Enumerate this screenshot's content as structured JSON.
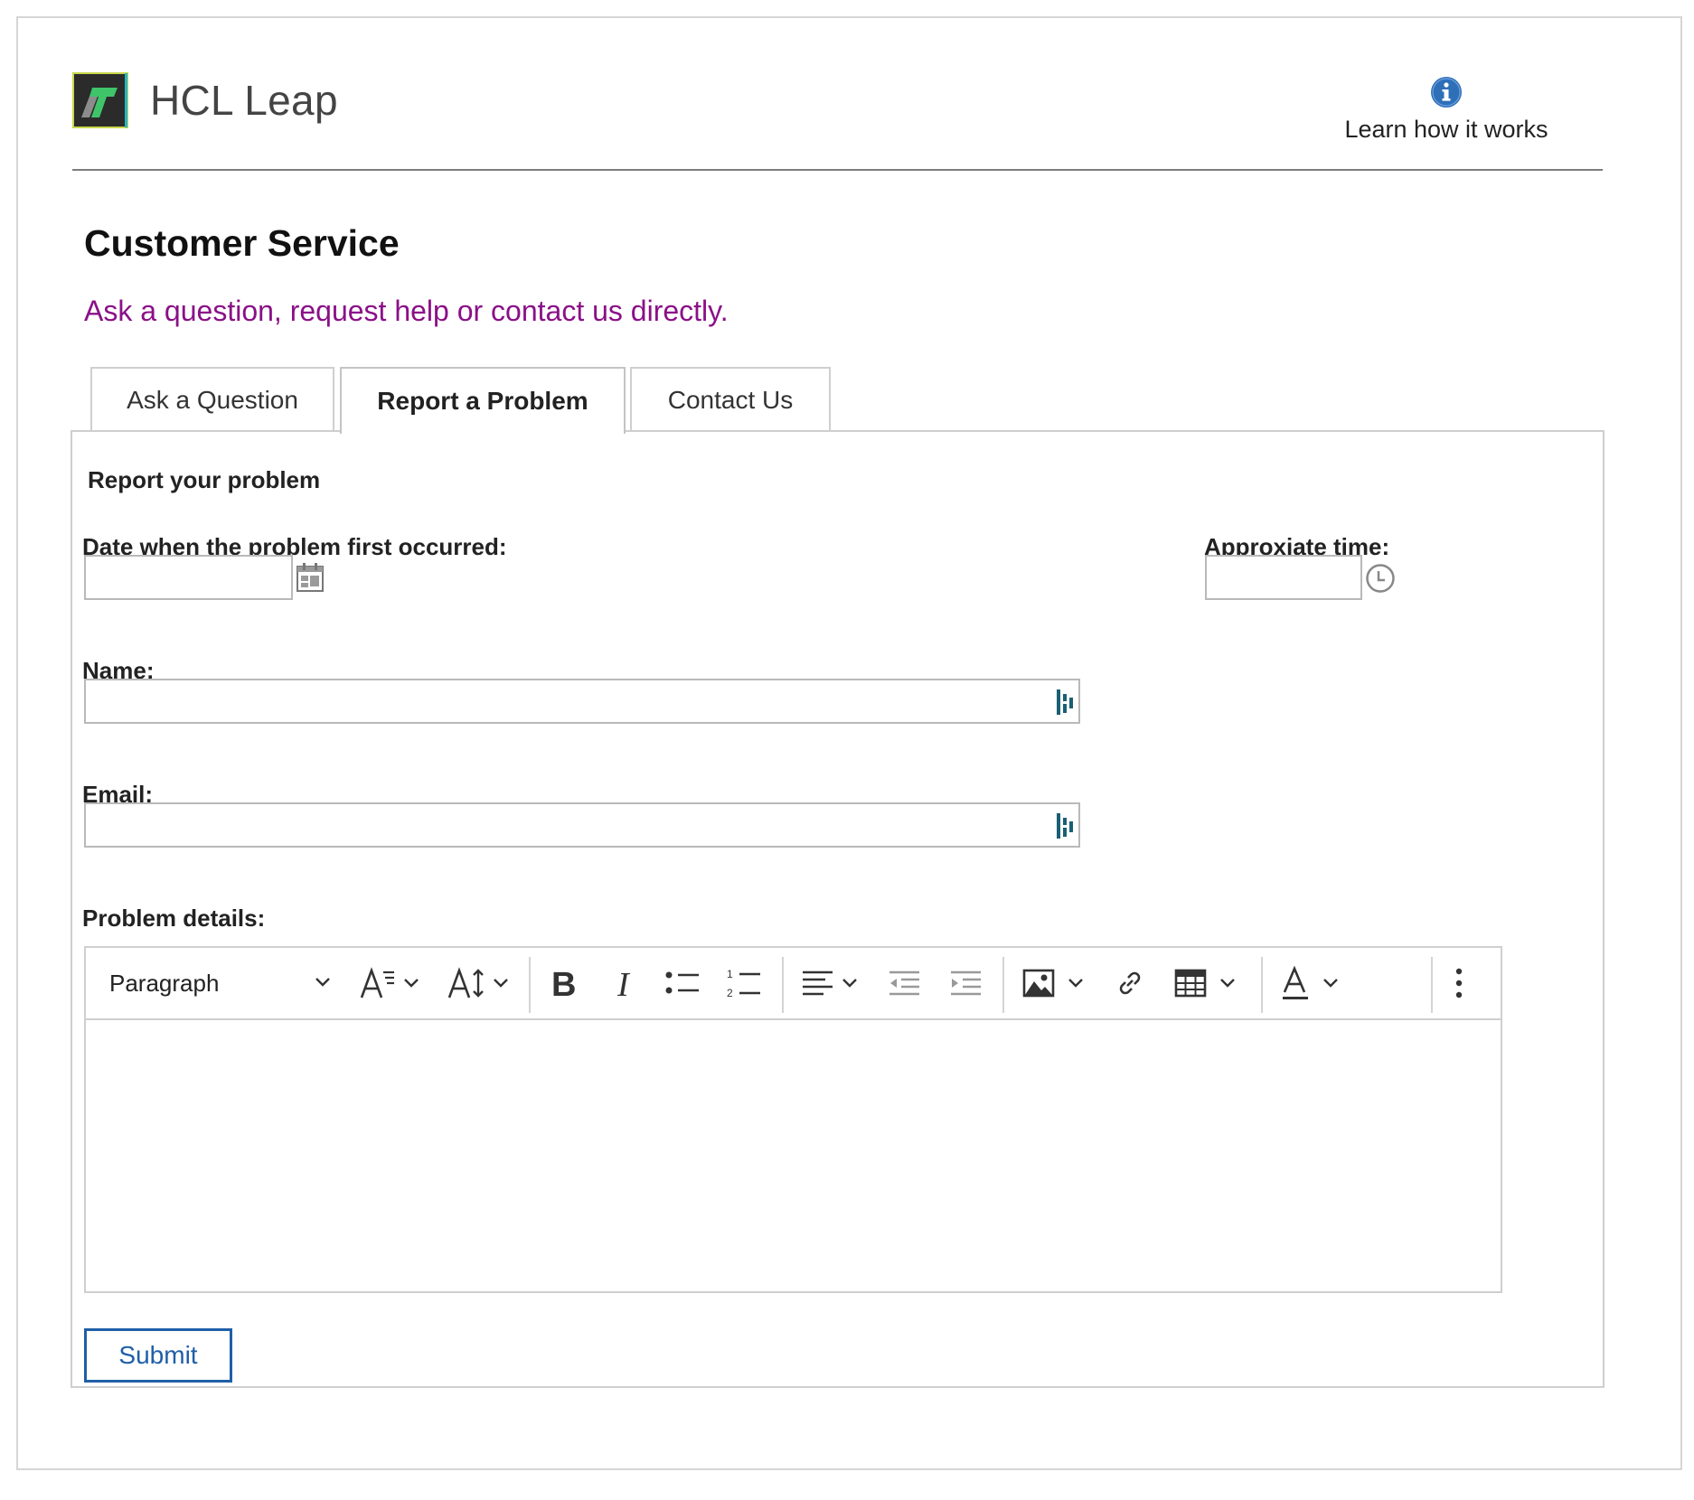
{
  "header": {
    "app_name": "HCL Leap",
    "help_link": "Learn how it works",
    "icons": {
      "logo": "hcl-leap-logo-icon",
      "help": "info-icon"
    }
  },
  "page": {
    "title": "Customer Service",
    "subtitle": "Ask a question, request help or contact us directly."
  },
  "tabs": [
    {
      "label": "Ask a Question",
      "active": false
    },
    {
      "label": "Report a Problem",
      "active": true
    },
    {
      "label": "Contact Us",
      "active": false
    }
  ],
  "form": {
    "section_title": "Report your problem",
    "date_label": "Date when the problem first occurred:",
    "date_value": "",
    "time_label": "Approxiate time:",
    "time_value": "",
    "name_label": "Name:",
    "name_value": "",
    "email_label": "Email:",
    "email_value": "",
    "details_label": "Problem details:",
    "details_value": "",
    "submit_label": "Submit"
  },
  "editor_toolbar": {
    "paragraph_select": "Paragraph",
    "icons": [
      "font-family-icon",
      "font-size-icon",
      "bold-icon",
      "italic-icon",
      "bulleted-list-icon",
      "numbered-list-icon",
      "align-left-icon",
      "outdent-icon",
      "indent-icon",
      "image-icon",
      "link-icon",
      "table-icon",
      "font-color-icon",
      "more-options-icon"
    ]
  },
  "colors": {
    "subtitle": "#8a1088",
    "submit_border": "#1f5ea8",
    "info_icon": "#2f6fb8",
    "password_manager_icon": "#1b5f74"
  }
}
